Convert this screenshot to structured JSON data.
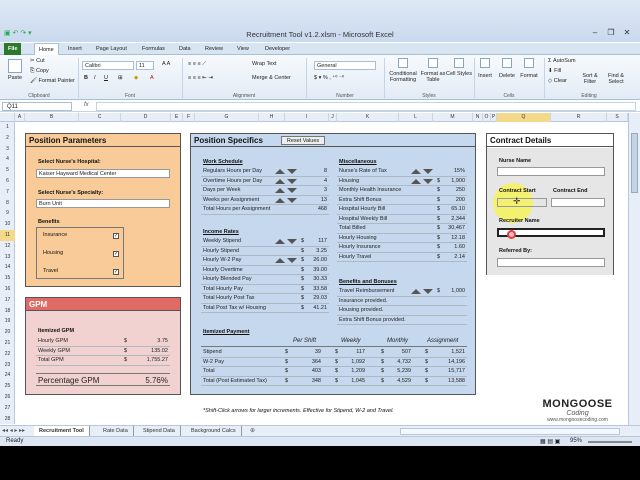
{
  "window": {
    "title": "Recruitment Tool v1.2.xlsm - Microsoft Excel"
  },
  "ribbon": {
    "tabs": [
      "File",
      "Home",
      "Insert",
      "Page Layout",
      "Formulas",
      "Data",
      "Review",
      "View",
      "Developer"
    ],
    "clipboard": {
      "paste": "Paste",
      "cut": "Cut",
      "copy": "Copy",
      "format_painter": "Format Painter",
      "label": "Clipboard"
    },
    "font": {
      "name": "Calibri",
      "size": "11",
      "label": "Font"
    },
    "alignment": {
      "wrap": "Wrap Text",
      "merge": "Merge & Center",
      "label": "Alignment"
    },
    "number": {
      "format": "General",
      "label": "Number"
    },
    "styles": {
      "conditional": "Conditional Formatting",
      "format_table": "Format as Table",
      "cell_styles": "Cell Styles",
      "label": "Styles"
    },
    "cells": {
      "insert": "Insert",
      "delete": "Delete",
      "format": "Format",
      "label": "Cells"
    },
    "editing": {
      "autosum": "AutoSum",
      "fill": "Fill",
      "clear": "Clear",
      "sort": "Sort & Filter",
      "find": "Find & Select",
      "label": "Editing"
    }
  },
  "formula_bar": {
    "name_box": "Q11",
    "fx": "fx"
  },
  "columns": [
    "A",
    "B",
    "C",
    "D",
    "E",
    "F",
    "G",
    "H",
    "I",
    "J",
    "K",
    "L",
    "M",
    "N",
    "O",
    "P",
    "Q",
    "R",
    "S"
  ],
  "rows": [
    "1",
    "2",
    "3",
    "4",
    "5",
    "6",
    "7",
    "8",
    "9",
    "10",
    "11",
    "12",
    "13",
    "14",
    "15",
    "16",
    "17",
    "18",
    "19",
    "20",
    "21",
    "22",
    "23",
    "24",
    "25",
    "26",
    "27",
    "28"
  ],
  "position_parameters": {
    "title": "Position Parameters",
    "hospital_label": "Select Nurse's Hospital:",
    "hospital_value": "Kaiser Hayward Medical Center",
    "specialty_label": "Select Nurse's Specialty:",
    "specialty_value": "Burn Unit",
    "benefits_label": "Benefits",
    "benefits": [
      {
        "label": "Insurance",
        "checked": "✓"
      },
      {
        "label": "Housing",
        "checked": "✓"
      },
      {
        "label": "Travel",
        "checked": "✓"
      }
    ]
  },
  "gpm": {
    "title": "GPM",
    "itemized_label": "Itemized GPM",
    "rows": [
      {
        "label": "Hourly GPM",
        "cur": "$",
        "value": "3.75"
      },
      {
        "label": "Weekly GPM",
        "cur": "$",
        "value": "135.02"
      },
      {
        "label": "Total GPM",
        "cur": "$",
        "value": "1,755.27"
      }
    ],
    "percentage_label": "Percentage GPM",
    "percentage_value": "5.76%"
  },
  "position_specifics": {
    "title": "Position Specifics",
    "reset_button": "Reset Values",
    "work_schedule": {
      "label": "Work Schedule",
      "rows": [
        {
          "label": "Regulars Hours per Day",
          "cur": "",
          "value": "8"
        },
        {
          "label": "Overtime Hours per Day",
          "cur": "",
          "value": "4"
        },
        {
          "label": "Days per Week",
          "cur": "",
          "value": "3"
        },
        {
          "label": "Weeks per Assignment",
          "cur": "",
          "value": "13"
        },
        {
          "label": "Total Hours per Assignment",
          "cur": "",
          "value": "468"
        }
      ]
    },
    "income_rates": {
      "label": "Income Rates",
      "rows": [
        {
          "label": "Weekly Stipend",
          "cur": "$",
          "value": "117"
        },
        {
          "label": "Hourly Stipend",
          "cur": "$",
          "value": "3.25"
        },
        {
          "label": "Hourly W-2 Pay",
          "cur": "$",
          "value": "26.00"
        },
        {
          "label": "Hourly Overtime",
          "cur": "$",
          "value": "39.00"
        },
        {
          "label": "Hourly Blended Pay",
          "cur": "$",
          "value": "30.33"
        },
        {
          "label": "Total Hourly Pay",
          "cur": "$",
          "value": "33.58"
        },
        {
          "label": "Total Hourly Post Tax",
          "cur": "$",
          "value": "29.03"
        },
        {
          "label": "Total Post Tax w/ Housing",
          "cur": "$",
          "value": "41.21"
        }
      ]
    },
    "miscellaneous": {
      "label": "Miscellaneous",
      "rows": [
        {
          "label": "Nurse's Rate of Tax",
          "cur": "",
          "value": "15%"
        },
        {
          "label": "Housing",
          "cur": "$",
          "value": "1,900"
        },
        {
          "label": "Monthly Health Insurance",
          "cur": "$",
          "value": "250"
        },
        {
          "label": "Extra Shift Bonus",
          "cur": "$",
          "value": "200"
        },
        {
          "label": "Hospital Hourly Bill",
          "cur": "$",
          "value": "65.10"
        },
        {
          "label": "Hospital Weekly Bill",
          "cur": "$",
          "value": "2,344"
        },
        {
          "label": "Total Billed",
          "cur": "$",
          "value": "30,467"
        },
        {
          "label": "Hourly Housing",
          "cur": "$",
          "value": "12.18"
        },
        {
          "label": "Hourly Insurance",
          "cur": "$",
          "value": "1.60"
        },
        {
          "label": "Hourly Travel",
          "cur": "$",
          "value": "2.14"
        }
      ]
    },
    "benefits_bonuses": {
      "label": "Benefits and Bonuses",
      "reimbursement_label": "Travel Reimbursement",
      "reimbursement_cur": "$",
      "reimbursement_value": "1,000",
      "notes": [
        "Insurance provided.",
        "Housing provided.",
        "Extra Shift Bonus provided."
      ]
    },
    "itemized_payment": {
      "label": "Itemized Payment",
      "headers": [
        "Per Shift",
        "Weekly",
        "Monthly",
        "Assignment"
      ],
      "rows": [
        {
          "label": "Stipend",
          "values": [
            "$",
            "39",
            "$",
            "117",
            "$",
            "507",
            "$",
            "1,521"
          ]
        },
        {
          "label": "W-2 Pay",
          "values": [
            "$",
            "364",
            "$",
            "1,092",
            "$",
            "4,732",
            "$",
            "14,196"
          ]
        },
        {
          "label": "Total",
          "values": [
            "$",
            "403",
            "$",
            "1,209",
            "$",
            "5,239",
            "$",
            "15,717"
          ]
        },
        {
          "label": "Total (Post Estimated Tax)",
          "values": [
            "$",
            "348",
            "$",
            "1,045",
            "$",
            "4,529",
            "$",
            "13,588"
          ]
        }
      ]
    },
    "footnote": "*Shift-Click arrows for larger increments.  Effective for Stipend, W-2 and Travel."
  },
  "contract_details": {
    "title": "Contract Details",
    "nurse_name_label": "Nurse Name",
    "contract_start_label": "Contract Start",
    "contract_end_label": "Contract End",
    "recruiter_label": "Recruiter Name",
    "referred_label": "Referred By:"
  },
  "logo": {
    "name": "MONGOOSE",
    "sub": "Coding",
    "url": "www.mongoosecoding.com"
  },
  "sheet_tabs": [
    "Recruitment Tool",
    "Rate Data",
    "Stipend Data",
    "Background Calcs"
  ],
  "status": {
    "ready": "Ready",
    "zoom": "95%"
  },
  "colors": {
    "file_tab": "#2b7a2b",
    "orange_panel": "#f8cb98",
    "pink_panel": "#f2d2d0",
    "blue_panel": "#c6d8ee",
    "highlight": "#f6f25a"
  }
}
